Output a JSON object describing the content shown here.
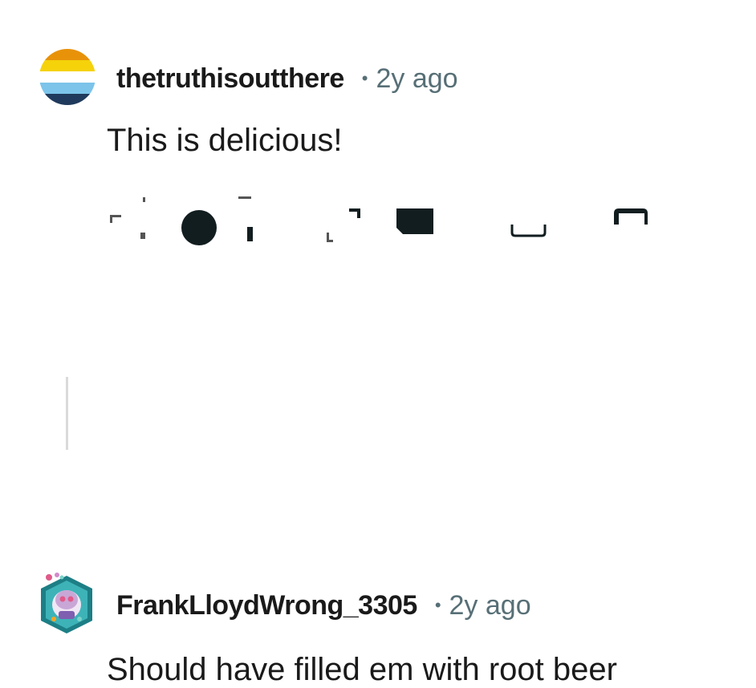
{
  "comments": [
    {
      "username": "thetruthisoutthere",
      "separator": "•",
      "age": "2y ago",
      "body": "This is delicious!",
      "avatar": "striped-flag-avatar",
      "avatar_colors": [
        "#e8920a",
        "#f5d20a",
        "#ffffff",
        "#7cc4ea",
        "#1f3a5c"
      ]
    },
    {
      "username": "FrankLloydWrong_3305",
      "separator": "•",
      "age": "2y ago",
      "body": "Should have filled em with root beer",
      "avatar": "snoo-character-avatar"
    }
  ],
  "action_bar": {
    "icons": [
      "upvote-icon",
      "vote-count-icon",
      "downvote-icon",
      "reply-icon",
      "award-icon",
      "share-icon",
      "more-icon"
    ]
  }
}
